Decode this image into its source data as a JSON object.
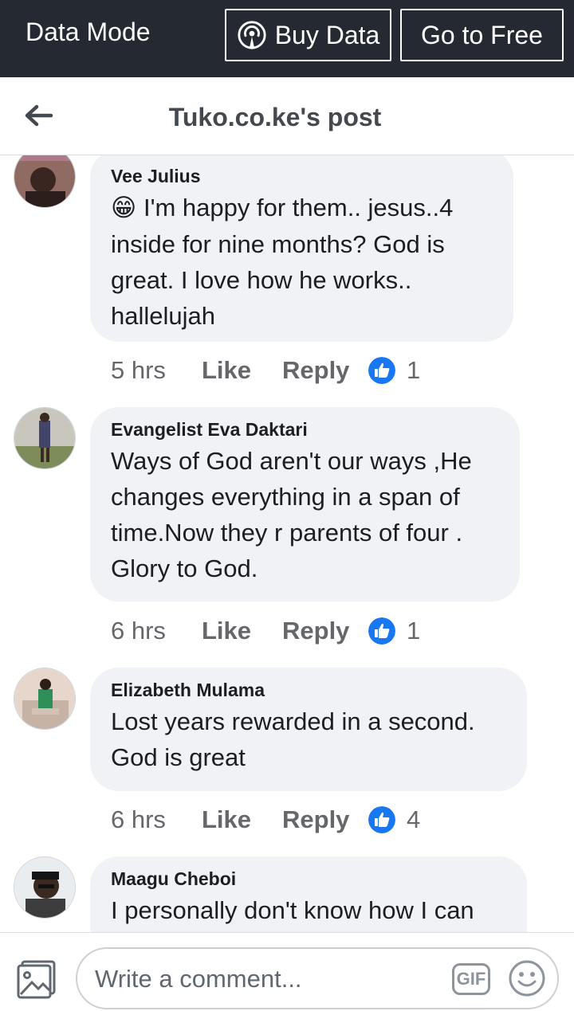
{
  "data_bar": {
    "mode_label": "Data Mode",
    "buy_data_label": "Buy Data",
    "go_free_label": "Go to Free"
  },
  "header": {
    "title": "Tuko.co.ke's post"
  },
  "comments": [
    {
      "author": "Vee Julius",
      "emoji": "😁",
      "text": "I'm happy for them.. jesus..4 inside for nine months? God is great. I love how he works.. hallelujah",
      "time": "5 hrs",
      "like_label": "Like",
      "reply_label": "Reply",
      "likes": "1"
    },
    {
      "author": "Evangelist Eva Daktari",
      "text": "Ways of God aren't our ways ,He changes everything in a span of time.Now they r parents of four . Glory to God.",
      "time": "6 hrs",
      "like_label": "Like",
      "reply_label": "Reply",
      "likes": "1"
    },
    {
      "author": "Elizabeth Mulama",
      "text": "Lost years rewarded in a second. God is great",
      "time": "6 hrs",
      "like_label": "Like",
      "reply_label": "Reply",
      "likes": "4"
    },
    {
      "author": "Maagu Cheboi",
      "text": "I personally don't know how I can"
    }
  ],
  "composer": {
    "placeholder": "Write a comment...",
    "gif_label": "GIF"
  },
  "colors": {
    "top_bar": "#252a32",
    "bubble": "#f0f2f5",
    "like_blue": "#1877f2",
    "meta_gray": "#65676b"
  },
  "icons": [
    "broadcast-icon",
    "back-arrow-icon",
    "like-reaction-icon",
    "photo-icon",
    "gif-icon",
    "smiley-icon"
  ]
}
